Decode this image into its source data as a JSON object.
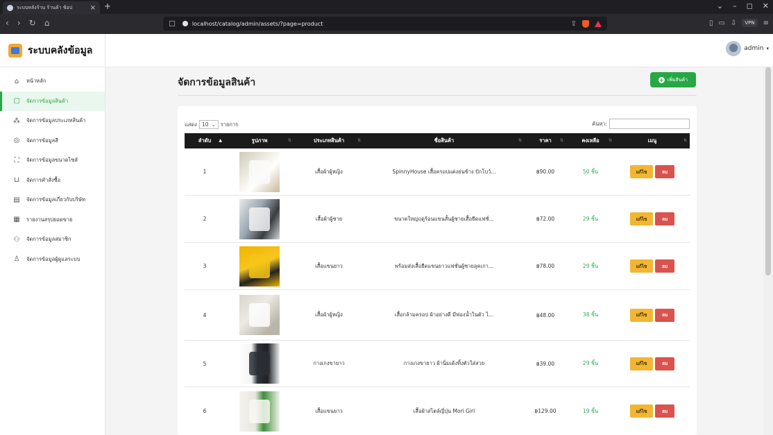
{
  "browser": {
    "tab_title": "ระบบหลังร้าน ร้านค้า ช้อป",
    "tab_close": "×",
    "new_tab": "+",
    "url": "localhost/catalog/admin/assets/?page=product",
    "vpn_label": "VPN"
  },
  "app": {
    "brand": "ระบบคลังข้อมูล",
    "user": "admin"
  },
  "sidebar": {
    "items": [
      {
        "label": "หน้าหลัก",
        "icon": "home-icon"
      },
      {
        "label": "จัดการข้อมูลสินค้า",
        "icon": "box-icon",
        "active": true
      },
      {
        "label": "จัดการข้อมูลประเภทสินค้า",
        "icon": "category-icon"
      },
      {
        "label": "จัดการข้อมูลสี",
        "icon": "palette-icon"
      },
      {
        "label": "จัดการข้อมูลขนาดไซส์",
        "icon": "size-icon"
      },
      {
        "label": "จัดการคำสั่งซื้อ",
        "icon": "cart-icon"
      },
      {
        "label": "จัดการข้อมูลเกี่ยวกับบริษัท",
        "icon": "company-icon"
      },
      {
        "label": "รายงานสรุปยอดขาย",
        "icon": "report-icon"
      },
      {
        "label": "จัดการข้อมูลสมาชิก",
        "icon": "members-icon"
      },
      {
        "label": "จัดการข้อมูลผู้ดูแลระบบ",
        "icon": "admin-icon"
      }
    ]
  },
  "page": {
    "title": "จัดการข้อมูลสินค้า",
    "add_button": "เพิ่มสินค้า"
  },
  "table": {
    "length_prefix": "แสดง",
    "length_value": "10",
    "length_suffix": "รายการ",
    "search_label": "ค้นหา:",
    "search_value": "",
    "headers": [
      "ลำดับ",
      "รูปภาพ",
      "ประเภทสินค้า",
      "ชื่อสินค้า",
      "ราคา",
      "คงเหลือ",
      "เมนู"
    ],
    "edit_label": "แก้ไข",
    "delete_label": "ลบ",
    "rows": [
      {
        "no": "1",
        "category": "เสื้อผ้าผู้หญิง",
        "name": "SpinnyHouse เสื้อครอปแต่งย่นข้าง ปักโบว์...",
        "price": "฿90.00",
        "stock": "50 ชิ้น"
      },
      {
        "no": "2",
        "category": "เสื้อผ้าผู้ชาย",
        "name": "ขนาดใหญ่ฤดูร้อนแขนสั้นผู้ชายเสื้อยืดแฟชั่...",
        "price": "฿72.00",
        "stock": "29 ชิ้น"
      },
      {
        "no": "3",
        "category": "เสื้อแขนยาว",
        "name": "พร้อมส่งเสื้อยืดแขนยาวแฟชั่นผู้ชายลุคเกา...",
        "price": "฿78.00",
        "stock": "29 ชิ้น"
      },
      {
        "no": "4",
        "category": "เสื้อผ้าผู้หญิง",
        "name": "เสื้อกล้ามครอป ผ้าอย่างดี มีฟองน้ำในตัว ไ...",
        "price": "฿48.00",
        "stock": "38 ชิ้น"
      },
      {
        "no": "5",
        "category": "กางเกงขายาว",
        "name": "กางเกงขายาว ผ้านิ่มเด้งทิ้งตัวใส่สวย",
        "price": "฿39.00",
        "stock": "29 ชิ้น"
      },
      {
        "no": "6",
        "category": "เสื้อแขนยาว",
        "name": "เสื้อผ้าสไตล์ญี่ปุ่น Mori Girl",
        "price": "฿129.00",
        "stock": "19 ชิ้น"
      }
    ]
  },
  "colors": {
    "accent": "#28a745",
    "table_header": "#1b1b1b",
    "edit": "#f2b632",
    "delete": "#d9534f"
  }
}
